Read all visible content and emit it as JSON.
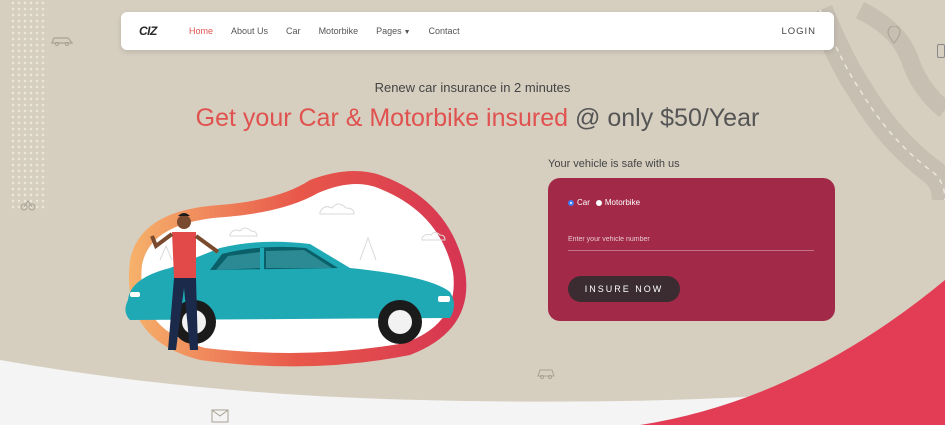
{
  "navbar": {
    "logo_text": "CIZ",
    "links": [
      {
        "label": "Home",
        "active": true
      },
      {
        "label": "About Us",
        "active": false
      },
      {
        "label": "Car",
        "active": false
      },
      {
        "label": "Motorbike",
        "active": false
      },
      {
        "label": "Pages",
        "active": false,
        "dropdown": true
      },
      {
        "label": "Contact",
        "active": false
      }
    ],
    "login_label": "LOGIN"
  },
  "hero": {
    "subtitle": "Renew car insurance in 2 minutes",
    "headline_accent": "Get your Car & Motorbike insured",
    "headline_rest": "@ only $50/Year"
  },
  "form": {
    "label": "Your vehicle is safe with us",
    "vehicle_types": [
      {
        "label": "Car",
        "checked": true
      },
      {
        "label": "Motorbike",
        "checked": false
      }
    ],
    "vehicle_number_placeholder": "Enter your vehicle number",
    "submit_label": "INSURE NOW"
  },
  "colors": {
    "accent": "#e0524f",
    "card": "#a22947",
    "button": "#3b2c31",
    "background": "#d6cfc0",
    "car": "#1ea9b5"
  },
  "icons": [
    "car-outline-icon",
    "motorbike-outline-icon",
    "parcel-outline-icon",
    "map-pin-icon",
    "chevron-down-icon"
  ]
}
